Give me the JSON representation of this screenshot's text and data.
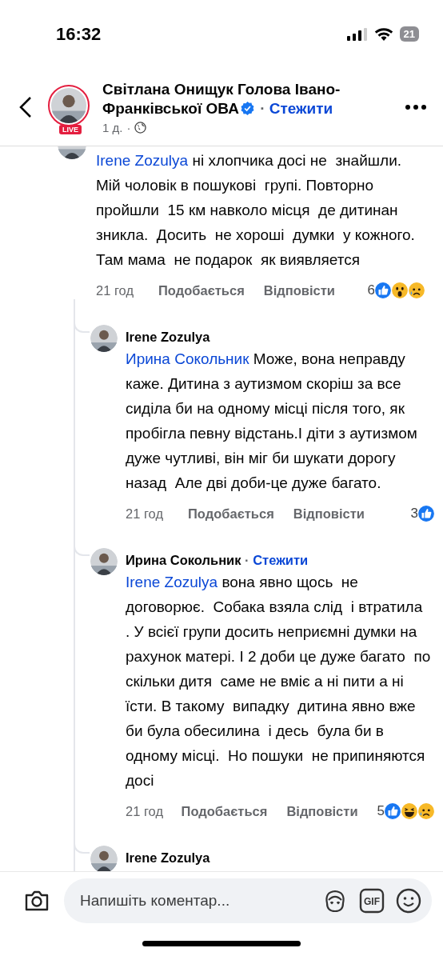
{
  "status_bar": {
    "time": "16:32",
    "battery": "21"
  },
  "header": {
    "author": "Світлана Онищук Голова Івано-Франківської ОВА",
    "verified": true,
    "follow": "Стежити",
    "live_badge": "LIVE",
    "time": "1 д.",
    "separator": "·"
  },
  "comment": {
    "mention": "Irene Zozulya",
    "text": "ні хлопчика досі не  знайшли.  Мій чоловік в пошукові  групі. Повторно  пройшли  15 км навколо місця  де дитинан зникла.  Досить  не хороші  думки  у кожного.  Там мама  не подарок  як виявляется",
    "time": "21 год",
    "like": "Подобається",
    "reply": "Відповісти",
    "reaction_count": "6",
    "reactions": [
      {
        "kind": "like"
      },
      {
        "kind": "wow"
      },
      {
        "kind": "sad"
      }
    ],
    "replies": [
      {
        "author": "Irene Zozulya",
        "mention": "Ирина Сокольник",
        "text": "Може, вона неправду каже. Дитина з аутизмом скоріш за все сиділа би на одному місці після того, як пробігла певну відстань.І діти з аутизмом дуже чутливі, він міг би шукати дорогу назад  Але дві доби-це дуже багато.",
        "time": "21 год",
        "like": "Подобається",
        "reply": "Відповісти",
        "reaction_count": "3",
        "reactions": [
          {
            "kind": "like"
          }
        ]
      },
      {
        "author": "Ирина Сокольник",
        "separator": "·",
        "follow": "Стежити",
        "mention": "Irene Zozulya",
        "text": "вона явно щось  не договорює.  Собака взяла слід  і втратила  . У всієї групи досить неприємні думки на рахунок матері. І 2 доби це дуже багато  по скільки дитя  саме не вміє а ні пити а ні їсти. В такому  випадку  дитина явно вже би була обесилина  і десь  була би в одному місці.  Но пошуки  не припиняются  досі",
        "time": "21 год",
        "like": "Подобається",
        "reply": "Відповісти",
        "reaction_count": "5",
        "reactions": [
          {
            "kind": "like"
          },
          {
            "kind": "haha"
          },
          {
            "kind": "sad"
          }
        ]
      },
      {
        "author": "Irene Zozulya"
      }
    ]
  },
  "composer": {
    "placeholder": "Напишіть коментар...",
    "gif_label": "GIF"
  }
}
